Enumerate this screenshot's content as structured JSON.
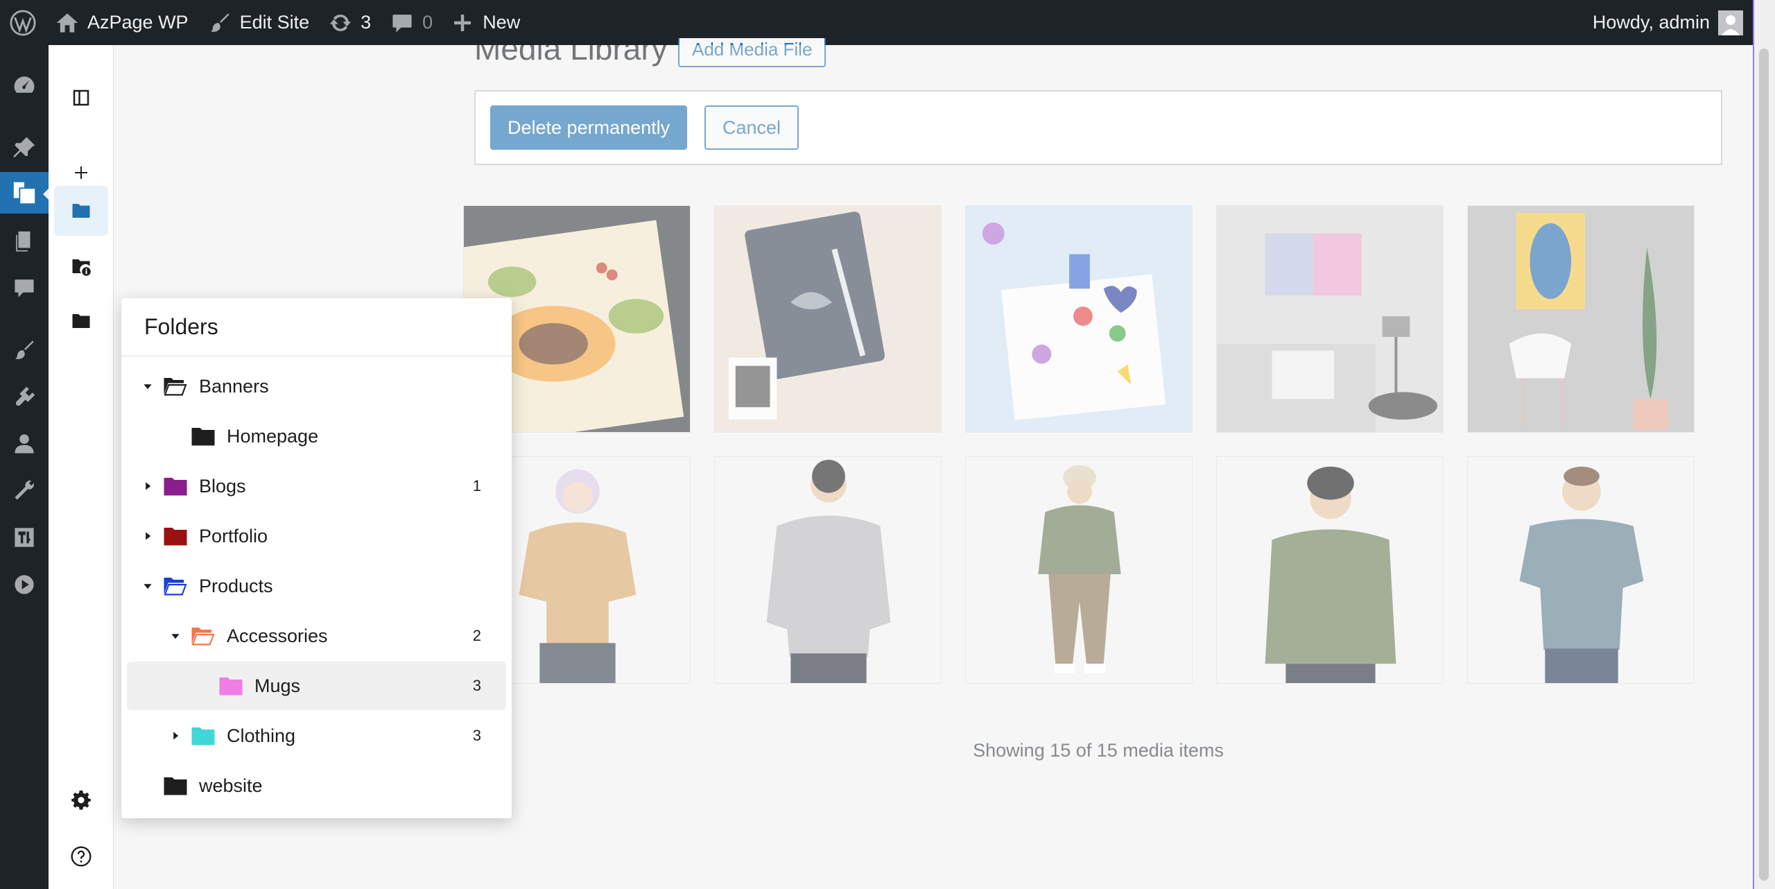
{
  "admin_bar": {
    "site_name": "AzPage WP",
    "edit_site": "Edit Site",
    "updates_count": "3",
    "comments_count": "0",
    "new_label": "New",
    "howdy": "Howdy, admin"
  },
  "page": {
    "title": "Media Library",
    "add_button": "Add Media File"
  },
  "bulk_actions": {
    "delete_label": "Delete permanently",
    "cancel_label": "Cancel"
  },
  "status": "Showing 15 of 15 media items",
  "folders_panel": {
    "title": "Folders",
    "items": [
      {
        "label": "Banners",
        "count": "",
        "color": "#1e1e1e",
        "state": "expanded"
      },
      {
        "label": "Homepage",
        "count": "",
        "color": "#1e1e1e",
        "state": "leaf"
      },
      {
        "label": "Blogs",
        "count": "1",
        "color": "#8a1e8c",
        "state": "collapsed"
      },
      {
        "label": "Portfolio",
        "count": "",
        "color": "#9b1111",
        "state": "collapsed"
      },
      {
        "label": "Products",
        "count": "",
        "color": "#1a3fd6",
        "state": "expanded"
      },
      {
        "label": "Accessories",
        "count": "2",
        "color": "#f0784a",
        "state": "expanded"
      },
      {
        "label": "Mugs",
        "count": "3",
        "color": "#f07ce6",
        "state": "leaf"
      },
      {
        "label": "Clothing",
        "count": "3",
        "color": "#3fd8d8",
        "state": "collapsed"
      },
      {
        "label": "website",
        "count": "",
        "color": "#1e1e1e",
        "state": "leaf"
      }
    ]
  },
  "colors": {
    "admin_bar_bg": "#1d2327",
    "accent": "#2271b1"
  }
}
